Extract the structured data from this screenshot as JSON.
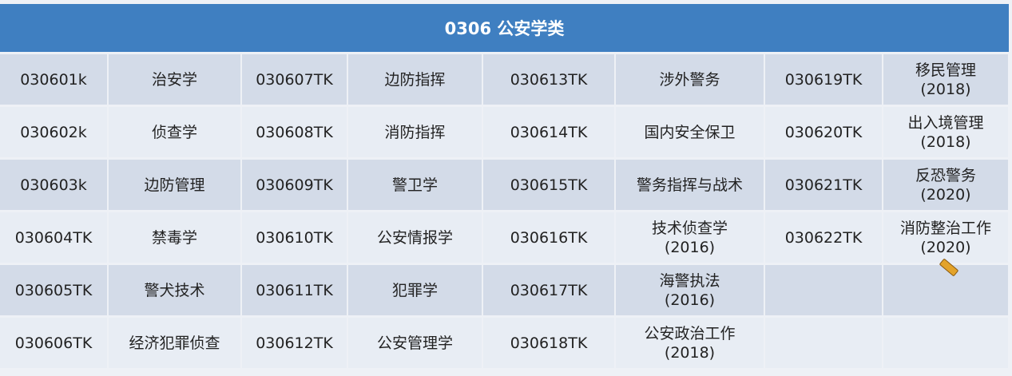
{
  "title": "0306  公安学类",
  "rows": [
    [
      {
        "code": "030601k",
        "name": "治安学"
      },
      {
        "code": "030607TK",
        "name": "边防指挥"
      },
      {
        "code": "030613TK",
        "name": "涉外警务"
      },
      {
        "code": "030619TK",
        "name": "移民管理",
        "year": "(2018)"
      }
    ],
    [
      {
        "code": "030602k",
        "name": "侦查学"
      },
      {
        "code": "030608TK",
        "name": "消防指挥"
      },
      {
        "code": "030614TK",
        "name": "国内安全保卫"
      },
      {
        "code": "030620TK",
        "name": "出入境管理",
        "year": "(2018)"
      }
    ],
    [
      {
        "code": "030603k",
        "name": "边防管理"
      },
      {
        "code": "030609TK",
        "name": "警卫学"
      },
      {
        "code": "030615TK",
        "name": "警务指挥与战术"
      },
      {
        "code": "030621TK",
        "name": "反恐警务",
        "year": "(2020)"
      }
    ],
    [
      {
        "code": "030604TK",
        "name": "禁毒学"
      },
      {
        "code": "030610TK",
        "name": "公安情报学"
      },
      {
        "code": "030616TK",
        "name": "技术侦查学",
        "year": "(2016)"
      },
      {
        "code": "030622TK",
        "name": "消防整治工作",
        "year": "(2020)"
      }
    ],
    [
      {
        "code": "030605TK",
        "name": "警犬技术"
      },
      {
        "code": "030611TK",
        "name": "犯罪学"
      },
      {
        "code": "030617TK",
        "name": "海警执法",
        "year": "(2016)"
      },
      {
        "code": "",
        "name": ""
      }
    ],
    [
      {
        "code": "030606TK",
        "name": "经济犯罪侦查"
      },
      {
        "code": "030612TK",
        "name": "公安管理学"
      },
      {
        "code": "030618TK",
        "name": "公安政治工作",
        "year": "(2018)"
      },
      {
        "code": "",
        "name": ""
      }
    ]
  ],
  "colors": {
    "header": "#3f7fc1",
    "row_dark": "#d3dbe8",
    "row_light": "#e8edf4"
  },
  "cursor_icon": "pencil-icon"
}
